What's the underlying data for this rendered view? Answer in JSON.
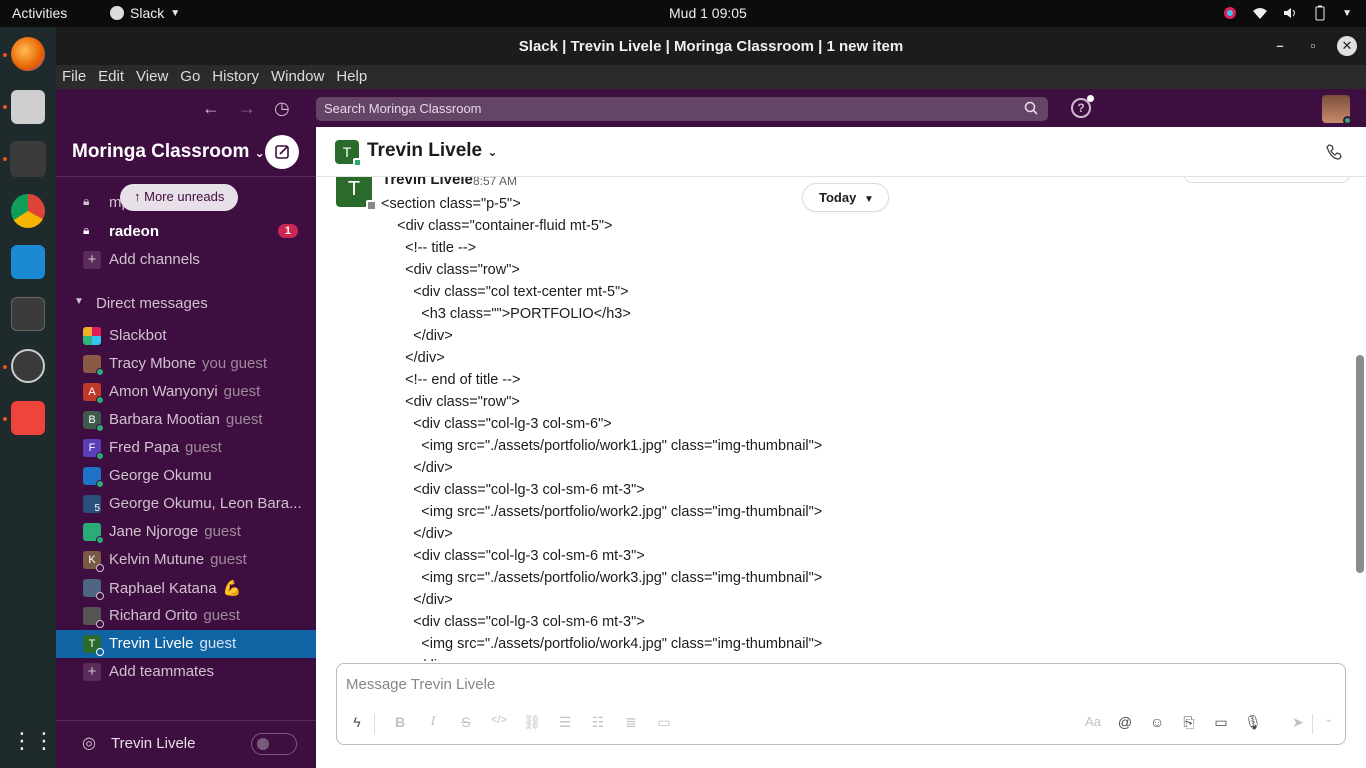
{
  "os": {
    "activities": "Activities",
    "app_name": "Slack",
    "clock": "Mud 1  09:05"
  },
  "window": {
    "title": "Slack | Trevin Livele | Moringa Classroom | 1 new item"
  },
  "menu": [
    "File",
    "Edit",
    "View",
    "Go",
    "History",
    "Window",
    "Help"
  ],
  "search": {
    "placeholder": "Search Moringa Classroom"
  },
  "workspace": {
    "name": "Moringa Classroom"
  },
  "sidebar": {
    "more_unreads": "More unreads",
    "channels": [
      {
        "label": "mp",
        "bold": false
      },
      {
        "label": "radeon",
        "bold": true,
        "badge": "1"
      }
    ],
    "add_channels": "Add channels",
    "dm_header": "Direct messages",
    "dms": [
      {
        "name": "Slackbot",
        "sub": "",
        "color": "#e01e5a"
      },
      {
        "name": "Tracy Mbone",
        "sub": "you  guest",
        "color": "#8a5a44"
      },
      {
        "name": "Amon Wanyonyi",
        "sub": "guest",
        "color": "#c0392b",
        "initial": "A"
      },
      {
        "name": "Barbara Mootian",
        "sub": "guest",
        "color": "#3d5a4c",
        "initial": "B"
      },
      {
        "name": "Fred Papa",
        "sub": "guest",
        "color": "#5b3fb6",
        "initial": "F"
      },
      {
        "name": "George Okumu",
        "sub": "",
        "color": "#1f72c7"
      },
      {
        "name": "George Okumu, Leon Bara...",
        "sub": "",
        "color": "#2a4f7a",
        "group": "5"
      },
      {
        "name": "Jane Njoroge",
        "sub": "guest",
        "color": "#2bac76"
      },
      {
        "name": "Kelvin Mutune",
        "sub": "guest",
        "color": "#7a5a44",
        "initial": "K"
      },
      {
        "name": "Raphael Katana",
        "sub": "💪",
        "color": "#4d6580"
      },
      {
        "name": "Richard Orito",
        "sub": "guest",
        "color": "#555555"
      },
      {
        "name": "Trevin Livele",
        "sub": "guest",
        "color": "#2a6b2c",
        "initial": "T",
        "active": true
      }
    ],
    "add_teammates": "Add teammates",
    "huddle_name": "Trevin Livele"
  },
  "channel": {
    "name": "Trevin Livele",
    "avatar_initial": "T"
  },
  "message": {
    "author": "Trevin Livele",
    "time": "8:57 AM",
    "avatar_initial": "T",
    "code_lines": [
      "<section class=\"p-5\">",
      "    <div class=\"container-fluid mt-5\">",
      "      <!-- title -->",
      "      <div class=\"row\">",
      "        <div class=\"col text-center mt-5\">",
      "          <h3 class=\"\">PORTFOLIO</h3>",
      "        </div>",
      "      </div>",
      "      <!-- end of title -->",
      "      <div class=\"row\">",
      "        <div class=\"col-lg-3 col-sm-6\">",
      "          <img src=\"./assets/portfolio/work1.jpg\" class=\"img-thumbnail\">",
      "        </div>",
      "        <div class=\"col-lg-3 col-sm-6 mt-3\">",
      "          <img src=\"./assets/portfolio/work2.jpg\" class=\"img-thumbnail\">",
      "        </div>",
      "        <div class=\"col-lg-3 col-sm-6 mt-3\">",
      "          <img src=\"./assets/portfolio/work3.jpg\" class=\"img-thumbnail\">",
      "        </div>",
      "        <div class=\"col-lg-3 col-sm-6 mt-3\">",
      "          <img src=\"./assets/portfolio/work4.jpg\" class=\"img-thumbnail\">",
      "        </div>"
    ]
  },
  "date_divider": "Today",
  "composer": {
    "placeholder": "Message Trevin Livele"
  },
  "colors": {
    "sidebar_bg": "#3f0e40",
    "active_row": "#1164a3",
    "badge": "#cd2553",
    "presence": "#2bac76"
  }
}
